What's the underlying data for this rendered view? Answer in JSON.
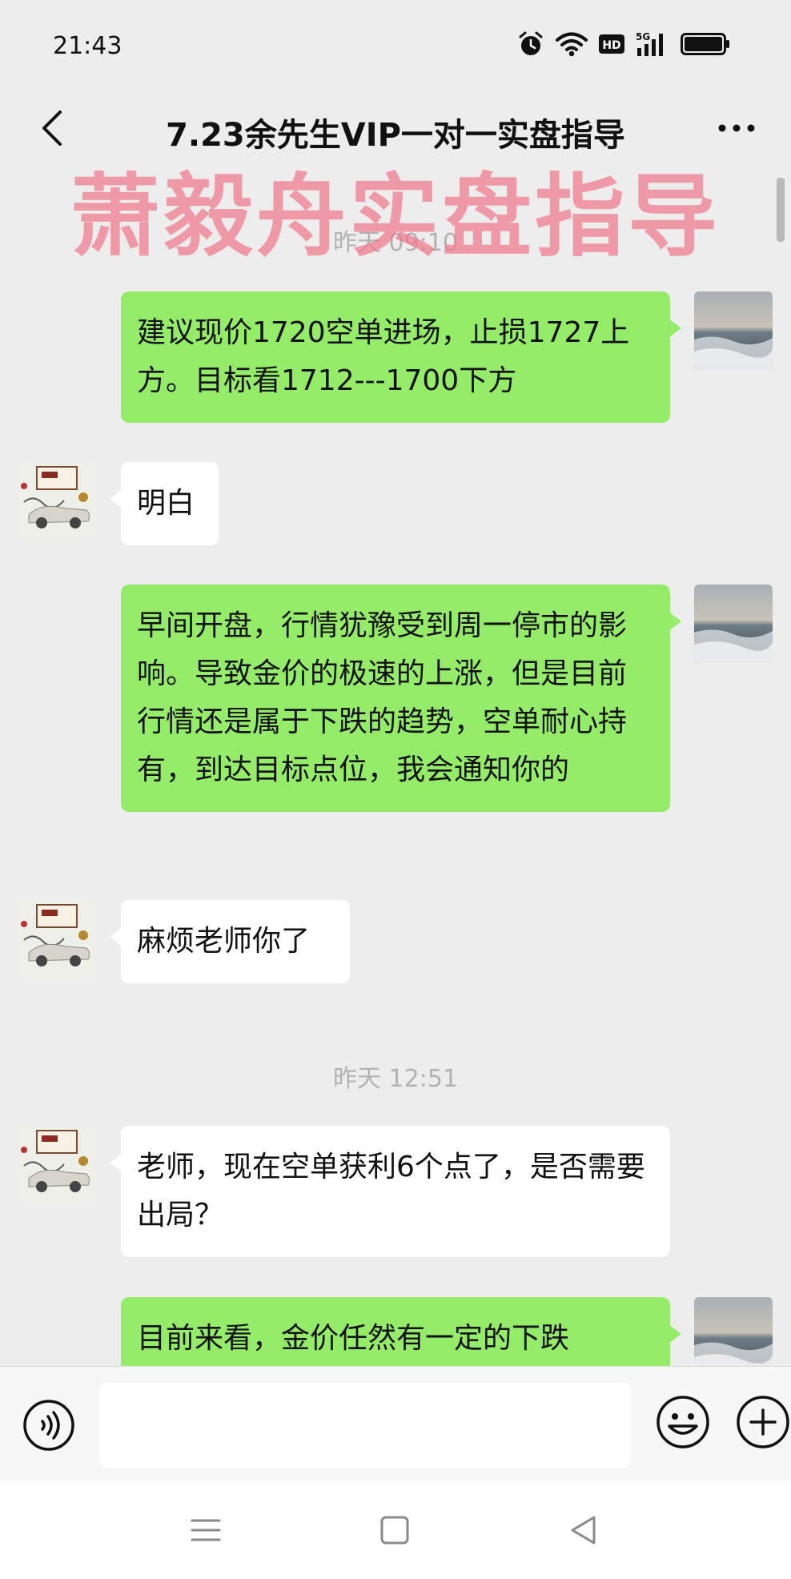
{
  "status_bar": {
    "time": "21:43",
    "icons": [
      "alarm-icon",
      "wifi-icon",
      "hd-icon",
      "5g-signal-icon",
      "battery-icon"
    ],
    "hd_label": "HD",
    "network_label": "5G"
  },
  "header": {
    "title": "7.23余先生VIP一对一实盘指导",
    "back_icon": "chevron-left-icon",
    "more_icon": "more-dots-icon"
  },
  "watermark": "萧毅舟实盘指导",
  "messages": [
    {
      "type": "time",
      "text": "昨天 09:10"
    },
    {
      "type": "message",
      "side": "right",
      "text": "建议现价1720空单进场，止损1727上方。目标看1712---1700下方"
    },
    {
      "type": "message",
      "side": "left",
      "text": "明白"
    },
    {
      "type": "message",
      "side": "right",
      "text": "早间开盘，行情犹豫受到周一停市的影响。导致金价的极速的上涨，但是目前行情还是属于下跌的趋势，空单耐心持有，到达目标点位，我会通知你的"
    },
    {
      "type": "message",
      "side": "left",
      "text": "麻烦老师你了"
    },
    {
      "type": "time",
      "text": "昨天 12:51"
    },
    {
      "type": "message",
      "side": "left",
      "text": "老师，现在空单获利6个点了，是否需要出局？"
    },
    {
      "type": "message",
      "side": "right",
      "text": "目前来看，金价任然有一定的下跌"
    }
  ],
  "input_bar": {
    "voice_icon": "voice-icon",
    "emoji_icon": "emoji-icon",
    "plus_icon": "plus-icon",
    "input_value": ""
  },
  "nav": [
    "menu-icon",
    "home-icon",
    "back-icon"
  ],
  "colors": {
    "background": "#ededed",
    "bubble_self": "#95ec69",
    "bubble_other": "#ffffff",
    "watermark": "#f0788c",
    "time_label": "#b2b2b2"
  }
}
